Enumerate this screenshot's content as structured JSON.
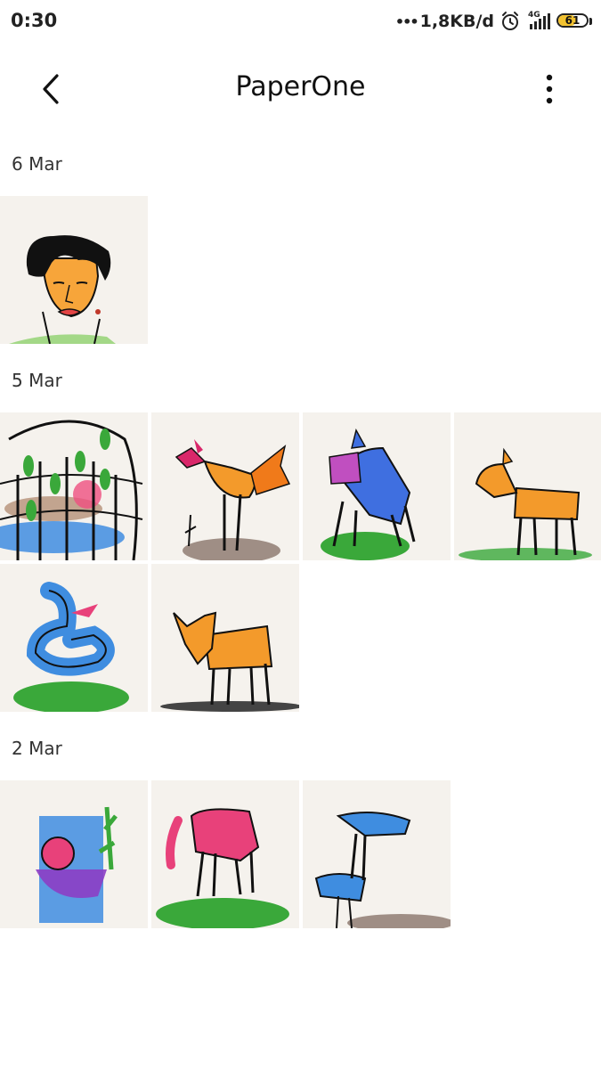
{
  "status_bar": {
    "time": "0:30",
    "network_dots": "•••",
    "network_speed": "1,8KB/d",
    "network_type": "4G",
    "battery_level": "61",
    "battery_fraction": 0.61,
    "icons": [
      "alarm-icon",
      "signal-icon",
      "battery-icon"
    ]
  },
  "app_bar": {
    "title": "PaperOne",
    "back_icon": "chevron-left-icon",
    "menu_icon": "more-vertical-icon"
  },
  "sections": [
    {
      "date": "6 Mar",
      "items": [
        "portrait-woman"
      ]
    },
    {
      "date": "5 Mar",
      "items": [
        "cage-garden",
        "rooster",
        "blue-horse",
        "orange-horse",
        "blue-snake",
        "orange-fox"
      ]
    },
    {
      "date": "2 Mar",
      "items": [
        "woman-with-plant",
        "pink-elephant",
        "blue-bird"
      ]
    }
  ],
  "colors": {
    "thumb_background": "#f5f2ed",
    "accent_orange": "#f39a2b",
    "accent_blue": "#3f8de0",
    "accent_green": "#3aa83a",
    "accent_pink": "#e8417a"
  }
}
